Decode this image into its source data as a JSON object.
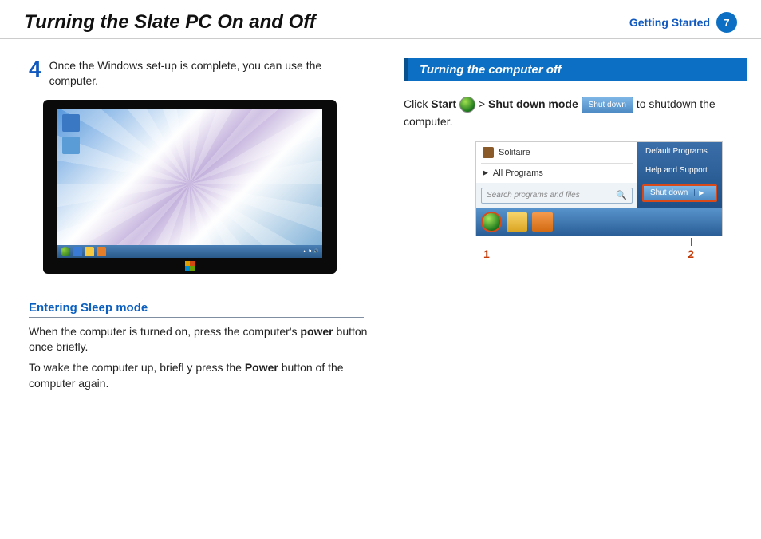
{
  "header": {
    "title": "Turning the Slate PC On and Off",
    "section": "Getting Started",
    "page": "7"
  },
  "left": {
    "step_num": "4",
    "step_text": "Once the Windows set-up is complete, you can use the computer.",
    "sleep_heading": "Entering Sleep mode",
    "sleep_p1_a": "When the computer is turned on, press the computer's ",
    "sleep_p1_b": "power",
    "sleep_p1_c": " button once briefly.",
    "sleep_p2_a": "To wake the computer up, briefl y press the ",
    "sleep_p2_b": "Power",
    "sleep_p2_c": " button of the computer again."
  },
  "right": {
    "section_title": "Turning the computer off",
    "click_a": "Click ",
    "click_start": "Start",
    "click_b": " > ",
    "click_sdmode": "Shut down mode",
    "click_c": " to shutdown the computer.",
    "shutdown_btn": "Shut down",
    "startmenu": {
      "solitaire": "Solitaire",
      "all_programs": "All Programs",
      "search_placeholder": "Search programs and files",
      "right_items": [
        "Default Programs",
        "Help and Support"
      ],
      "shutdown": "Shut down"
    },
    "callout1": "1",
    "callout2": "2"
  }
}
